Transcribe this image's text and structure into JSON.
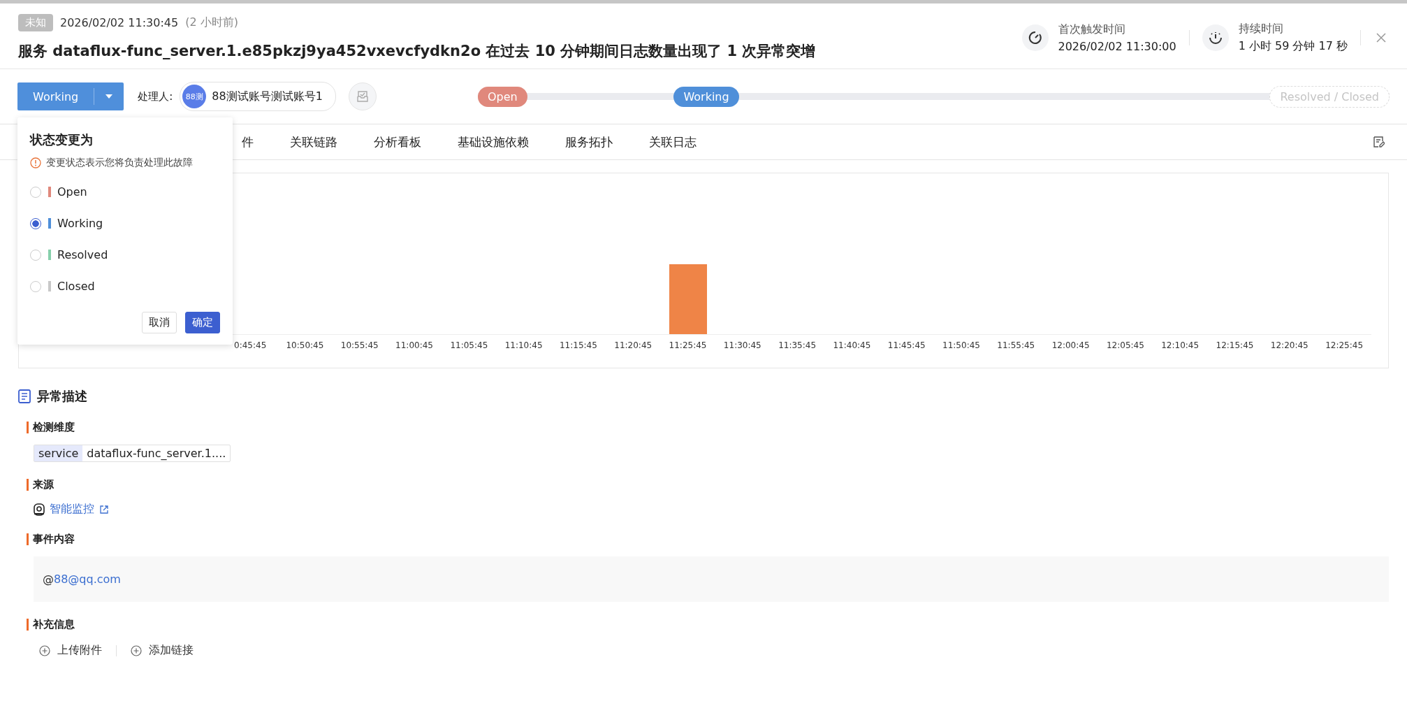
{
  "header": {
    "severity_badge": "未知",
    "timestamp": "2026/02/02 11:30:45",
    "relative_time": "(2 小时前)",
    "title": "服务 dataflux-func_server.1.e85pkzj9ya452vxevcfydkn2o 在过去 10 分钟期间日志数量出现了 1 次异常突增",
    "stats": [
      {
        "kind": "first",
        "label": "首次触发时间",
        "value": "2026/02/02 11:30:00"
      },
      {
        "kind": "duration",
        "label": "持续时间",
        "value": "1 小时 59 分钟 17 秒"
      }
    ]
  },
  "toolbar": {
    "status_button": "Working",
    "assignee_label": "处理人:",
    "assignee": {
      "avatar": "88测",
      "name": "88测试账号测试账号1"
    }
  },
  "pipeline": [
    {
      "label": "Open",
      "active": true,
      "color": "#e0887c"
    },
    {
      "label": "Working",
      "active": true,
      "color": "#4f8fd9"
    },
    {
      "label": "Resolved / Closed",
      "active": false
    }
  ],
  "tabs": [
    {
      "label": "件",
      "selected": false
    },
    {
      "label": "关联链路",
      "selected": false
    },
    {
      "label": "分析看板",
      "selected": false
    },
    {
      "label": "基础设施依赖",
      "selected": false
    },
    {
      "label": "服务拓扑",
      "selected": false
    },
    {
      "label": "关联日志",
      "selected": false
    }
  ],
  "chart": {
    "x_labels": [
      {
        "label": "0:45:45",
        "spike": false
      },
      {
        "label": "10:50:45",
        "spike": false
      },
      {
        "label": "10:55:45",
        "spike": false
      },
      {
        "label": "11:00:45",
        "spike": false
      },
      {
        "label": "11:05:45",
        "spike": false
      },
      {
        "label": "11:10:45",
        "spike": false
      },
      {
        "label": "11:15:45",
        "spike": false
      },
      {
        "label": "11:20:45",
        "spike": false
      },
      {
        "label": "11:25:45",
        "spike": true
      },
      {
        "label": "11:30:45",
        "spike": false
      },
      {
        "label": "11:35:45",
        "spike": false
      },
      {
        "label": "11:40:45",
        "spike": false
      },
      {
        "label": "11:45:45",
        "spike": false
      },
      {
        "label": "11:50:45",
        "spike": false
      },
      {
        "label": "11:55:45",
        "spike": false
      },
      {
        "label": "12:00:45",
        "spike": false
      },
      {
        "label": "12:05:45",
        "spike": false
      },
      {
        "label": "12:10:45",
        "spike": false
      },
      {
        "label": "12:15:45",
        "spike": false
      },
      {
        "label": "12:20:45",
        "spike": false
      },
      {
        "label": "12:25:45",
        "spike": false
      }
    ]
  },
  "status_menu": {
    "title": "状态变更为",
    "notice": "变更状态表示您将负责处理此故障",
    "options": [
      {
        "label": "Open",
        "color": "#e0887c",
        "selected": false
      },
      {
        "label": "Working",
        "color": "#4f8fd9",
        "selected": true
      },
      {
        "label": "Resolved",
        "color": "#86d0ab",
        "selected": false
      },
      {
        "label": "Closed",
        "color": "#c8c8c8",
        "selected": false
      }
    ],
    "buttons": [
      {
        "label": "取消",
        "kind": "default"
      },
      {
        "label": "确定",
        "kind": "primary"
      }
    ]
  },
  "description": {
    "title": "异常描述",
    "sections": [
      {
        "kind": "tags",
        "label": "检测维度",
        "tags": [
          {
            "key": "service",
            "value": "dataflux-func_server.1...."
          }
        ]
      },
      {
        "kind": "link",
        "label": "来源",
        "link": "智能监控"
      },
      {
        "kind": "content",
        "label": "事件内容",
        "prefix": "@",
        "mention": "88@qq.com"
      },
      {
        "kind": "actions",
        "label": "补充信息",
        "actions": [
          "上传附件",
          "添加链接"
        ]
      }
    ]
  }
}
